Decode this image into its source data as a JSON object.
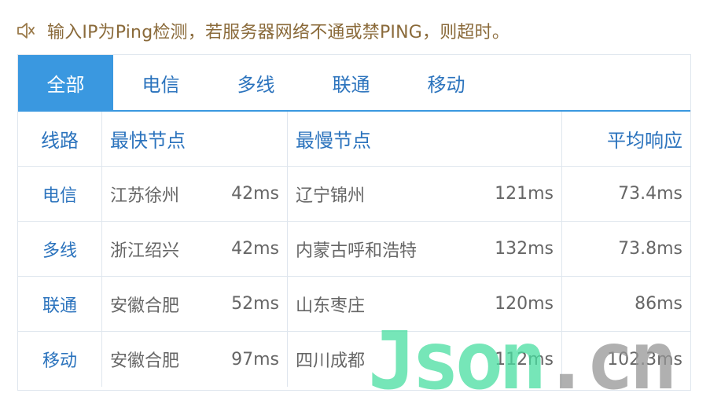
{
  "notice": {
    "icon": "speaker-icon",
    "text": "输入IP为Ping检测，若服务器网络不通或禁PING，则超时。"
  },
  "tabs": [
    {
      "label": "全部",
      "active": true
    },
    {
      "label": "电信",
      "active": false
    },
    {
      "label": "多线",
      "active": false
    },
    {
      "label": "联通",
      "active": false
    },
    {
      "label": "移动",
      "active": false
    }
  ],
  "table": {
    "headers": [
      "线路",
      "最快节点",
      "最慢节点",
      "平均响应"
    ],
    "rows": [
      {
        "line": "电信",
        "fastest_node": "江苏徐州",
        "fastest_ms": "42ms",
        "slowest_node": "辽宁锦州",
        "slowest_ms": "121ms",
        "avg": "73.4ms"
      },
      {
        "line": "多线",
        "fastest_node": "浙江绍兴",
        "fastest_ms": "42ms",
        "slowest_node": "内蒙古呼和浩特",
        "slowest_ms": "132ms",
        "avg": "73.8ms"
      },
      {
        "line": "联通",
        "fastest_node": "安徽合肥",
        "fastest_ms": "52ms",
        "slowest_node": "山东枣庄",
        "slowest_ms": "120ms",
        "avg": "86ms"
      },
      {
        "line": "移动",
        "fastest_node": "安徽合肥",
        "fastest_ms": "97ms",
        "slowest_node": "四川成都",
        "slowest_ms": "112ms",
        "avg": "102.3ms"
      }
    ]
  },
  "watermark": {
    "part1": "Json",
    "part2": ".cn"
  },
  "colors": {
    "accent": "#3a98e0",
    "link": "#2b73bd",
    "notice_text": "#8a6a3a"
  }
}
